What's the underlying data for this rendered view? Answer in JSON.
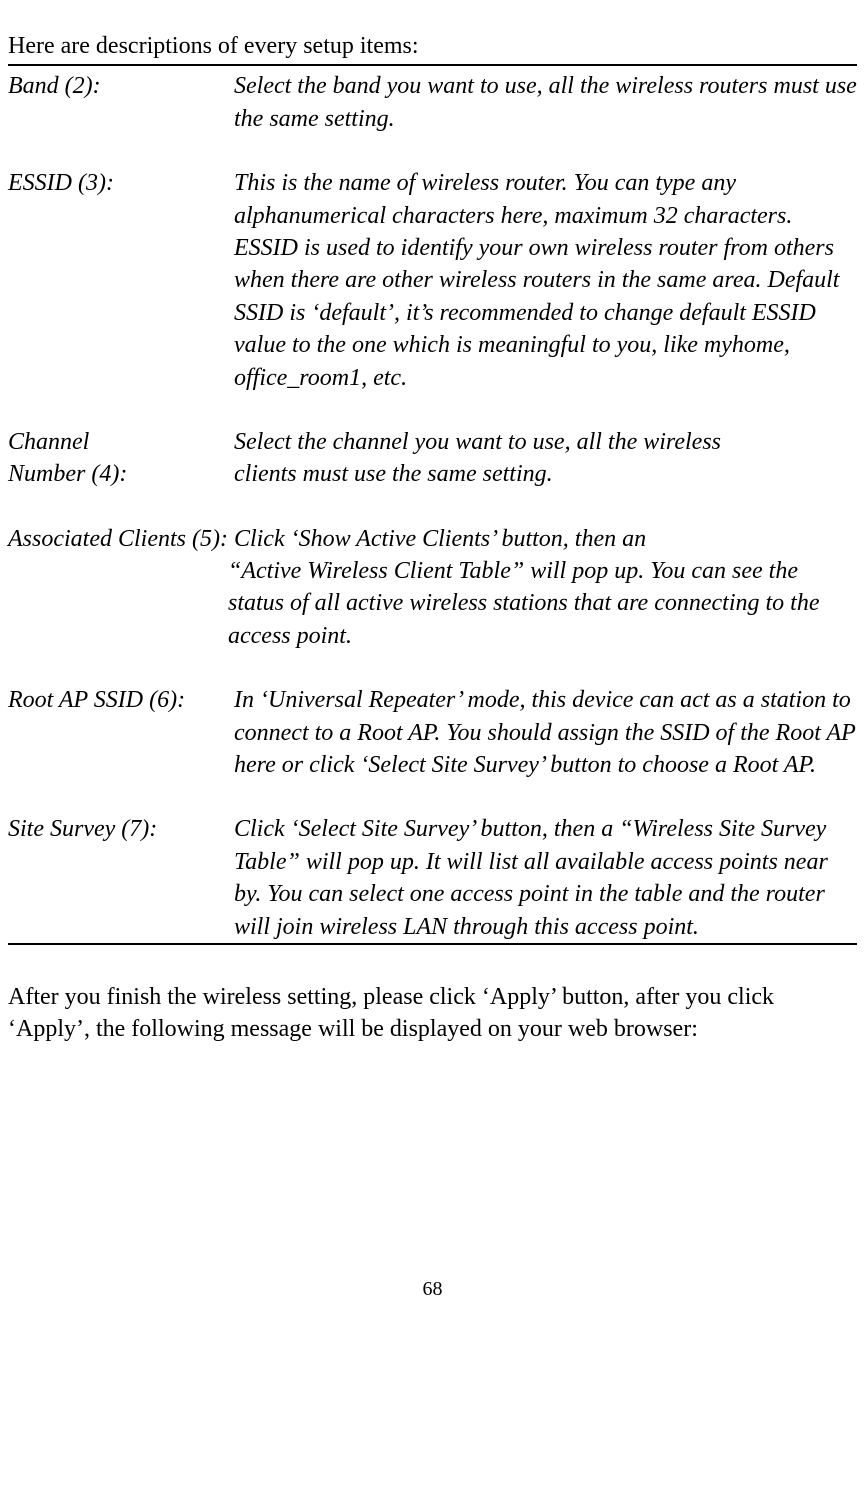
{
  "intro": "Here are descriptions of every setup items:",
  "items": {
    "band": {
      "label": "Band (2):",
      "desc": "Select the band you want to use, all the wireless routers must use the same setting."
    },
    "essid": {
      "label": "ESSID (3):",
      "desc": "This is the name of wireless router. You can type any alphanumerical characters here, maximum 32 characters. ESSID is used to identify your own wireless router from others when there are other wireless routers in the same area. Default SSID is ‘default’, it’s recommended to change default ESSID value to the one which is meaningful to you, like myhome, office_room1, etc."
    },
    "channel": {
      "label1": "Channel",
      "label2": "Number (4):",
      "desc1": "Select the channel you want to use, all the wireless",
      "desc2": "clients must use the same setting."
    },
    "associated": {
      "line1": "Associated Clients (5): Click ‘Show Active Clients’ button, then an",
      "rest": "“Active Wireless Client Table” will pop up. You can see the status of all active wireless stations that are connecting to the access point."
    },
    "rootap": {
      "label": "Root AP SSID (6):",
      "desc": "In ‘Universal Repeater’ mode, this device can act as a station to connect to a Root AP. You should assign the SSID of the Root AP here or click ‘Select Site Survey’ button to choose a Root AP."
    },
    "sitesurvey": {
      "label": "Site Survey (7):",
      "desc": "Click ‘Select Site Survey’ button, then a “Wireless Site Survey Table” will pop up. It will list all available access points near by. You can select one access point in the table and the router will join wireless LAN through this access point."
    }
  },
  "after": "After you finish the wireless setting, please click ‘Apply’ button, after you click ‘Apply’, the following message will be displayed on your web browser:",
  "page_number": "68"
}
